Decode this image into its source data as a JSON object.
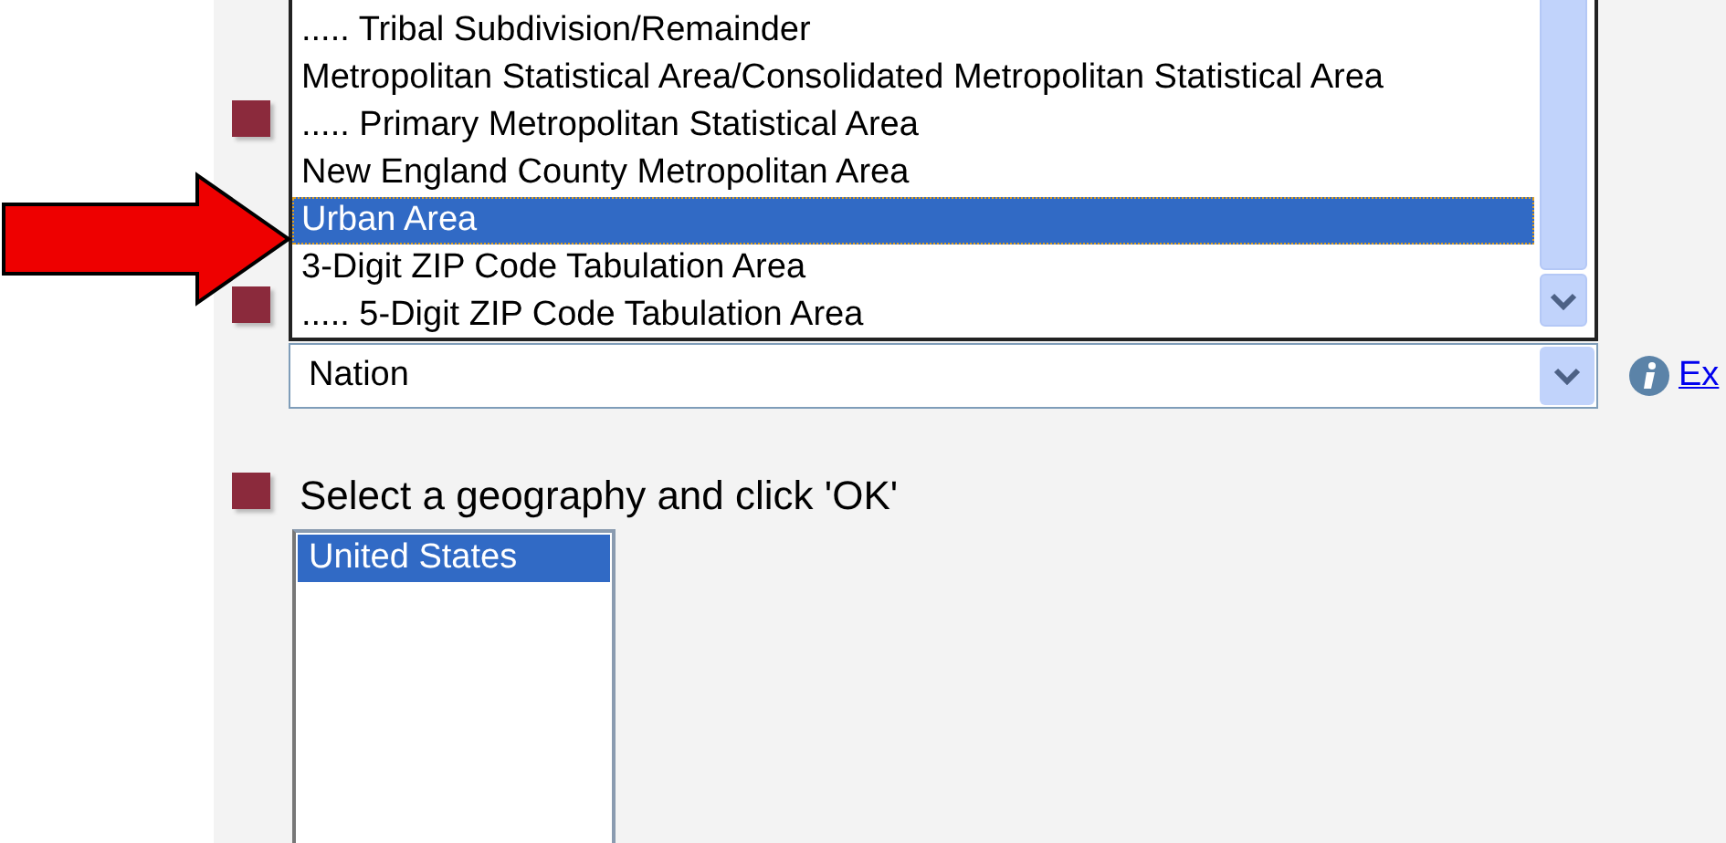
{
  "dropdown_list": {
    "items": [
      {
        "label": "..... Tribal Subdivision/Remainder",
        "selected": false
      },
      {
        "label": "Metropolitan Statistical Area/Consolidated Metropolitan Statistical Area",
        "selected": false
      },
      {
        "label": "..... Primary Metropolitan Statistical Area",
        "selected": false
      },
      {
        "label": "New England County Metropolitan Area",
        "selected": false
      },
      {
        "label": "Urban Area",
        "selected": true
      },
      {
        "label": "3-Digit ZIP Code Tabulation Area",
        "selected": false
      },
      {
        "label": "..... 5-Digit ZIP Code Tabulation Area",
        "selected": false
      }
    ]
  },
  "geo_level_select": {
    "value": "Nation"
  },
  "info_link": {
    "text": "Ex"
  },
  "instruction": "Select a geography and click 'OK'",
  "geography_list": {
    "items": [
      {
        "label": "United States",
        "selected": true
      }
    ]
  }
}
